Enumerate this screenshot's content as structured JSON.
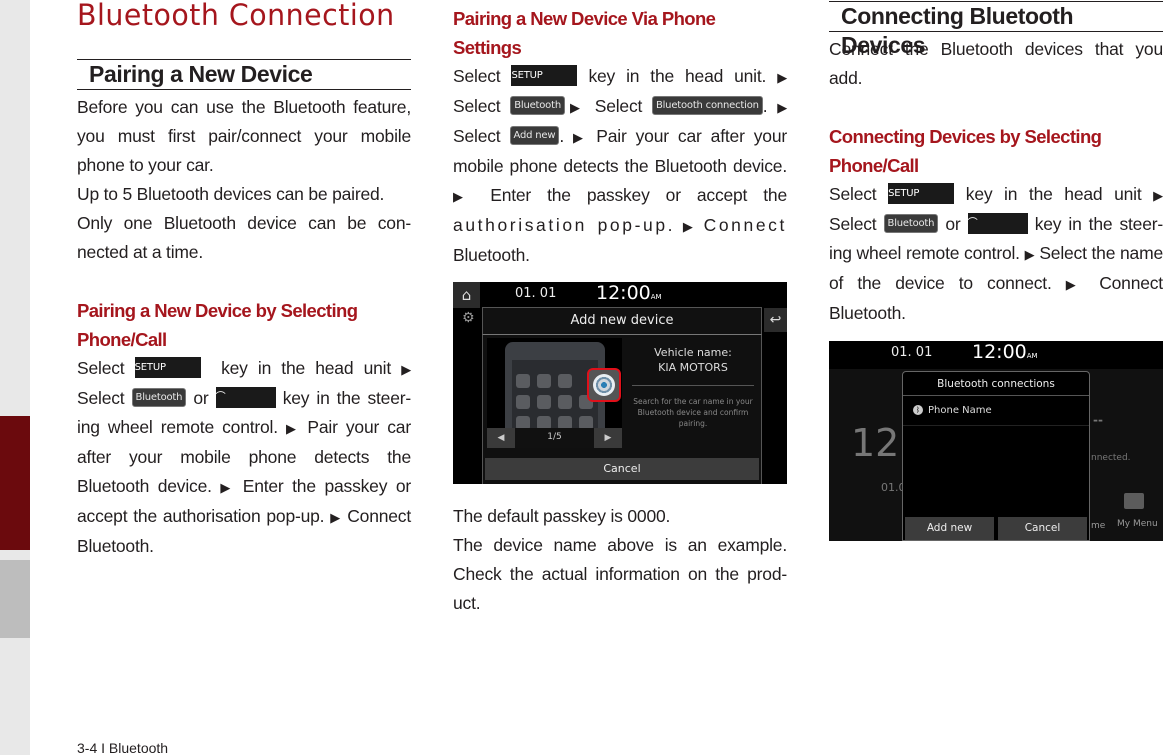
{
  "page": {
    "chapter_title": "Bluetooth Connection",
    "footer": "3-4 I Bluetooth"
  },
  "keys": {
    "setup": "SETUP",
    "bluetooth": "Bluetooth",
    "bluetooth_connection": "Bluetooth connection",
    "add_new": "Add new",
    "call_icon": "⌒",
    "arrow": "▶"
  },
  "col1": {
    "section_heading": "Pairing a New Device",
    "intro_1": "Before you can use the Bluetooth feature, you must first pair/connect your mobile phone to your car.",
    "intro_2": "Up to 5 Bluetooth devices can be paired.",
    "intro_3": "Only one Bluetooth device can be con-nected at a time.",
    "sub_heading": "Pairing a New Device by Selecting Phone/Call",
    "steps": {
      "select": "Select",
      "key_in_head_unit": "key in the head unit",
      "or": "or",
      "key_in_steering": "key in the steer-ing wheel remote control.",
      "pair": "Pair your car after your mobile phone detects the Bluetooth device.",
      "enter": "Enter the passkey or accept the authorisation pop-up.",
      "connect": "Connect Bluetooth."
    }
  },
  "col2": {
    "sub_heading": "Pairing a New Device Via Phone Settings",
    "steps": {
      "select": "Select",
      "key_in_head_unit": "key in the head unit.",
      "pair": "Pair your car after your mobile phone detects the Bluetooth device.",
      "enter": "Enter the passkey or accept the",
      "authorisation": "authorisation pop-up.",
      "connect": "Connect",
      "bluetooth": "Bluetooth."
    },
    "screen": {
      "date": "01. 01",
      "time": "12:00",
      "ampm": "AM",
      "title": "Add new device",
      "pager": "1/5",
      "vehicle_label": "Vehicle name:",
      "vehicle_name": "KIA MOTORS",
      "hint": "Search for the car name in your Bluetooth device and confirm pairing.",
      "cancel": "Cancel"
    },
    "note_1": "The default passkey is 0000.",
    "note_2": "The device name above is an example. Check the actual information on the prod-uct."
  },
  "col3": {
    "section_heading": "Connecting Bluetooth Devices",
    "intro": "Connect the Bluetooth devices that you add.",
    "sub_heading": "Connecting Devices by Selecting Phone/Call",
    "steps": {
      "select": "Select",
      "key_in_head_unit": "key in the head unit",
      "or": "or",
      "key_in_steering": "key in the steer-ing wheel remote control.",
      "select_name": "Select the name of the device to connect.",
      "connect": "Connect Bluetooth."
    },
    "screen": {
      "date": "01. 01",
      "time": "12:00",
      "ampm": "AM",
      "popup_title": "Bluetooth connections",
      "device": "Phone Name",
      "add_new": "Add new",
      "cancel": "Cancel",
      "bg_clock": "12",
      "bg_date": "01.0",
      "bg_dashes": "--",
      "bg_status": "nnected.",
      "bg_me": "me",
      "bg_menu": "My Menu"
    }
  }
}
